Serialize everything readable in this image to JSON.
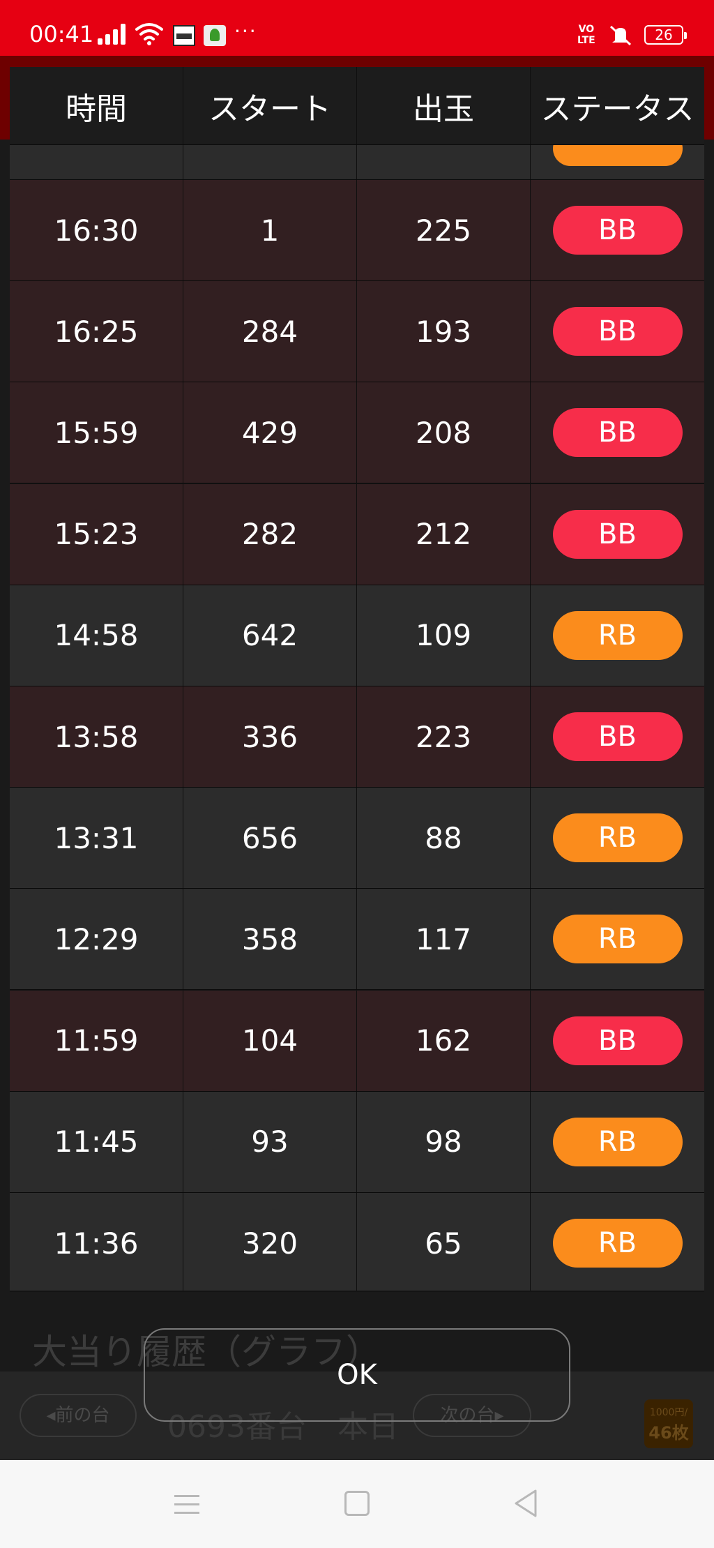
{
  "status_bar": {
    "time": "00:41",
    "more": "···",
    "volte": [
      "VO",
      "LTE"
    ],
    "battery": "26",
    "icons": [
      "signal-icon",
      "wifi-icon",
      "app-notification-icon",
      "app-notification-icon",
      "volte-icon",
      "mute-icon",
      "battery-icon"
    ]
  },
  "table": {
    "headers": [
      "時間",
      "スタート",
      "出玉",
      "ステータス"
    ],
    "rows": [
      {
        "time": "16:30",
        "start": "1",
        "payout": "225",
        "status": "BB"
      },
      {
        "time": "16:25",
        "start": "284",
        "payout": "193",
        "status": "BB"
      },
      {
        "time": "15:59",
        "start": "429",
        "payout": "208",
        "status": "BB"
      },
      {
        "time": "15:23",
        "start": "282",
        "payout": "212",
        "status": "BB"
      },
      {
        "time": "14:58",
        "start": "642",
        "payout": "109",
        "status": "RB"
      },
      {
        "time": "13:58",
        "start": "336",
        "payout": "223",
        "status": "BB"
      },
      {
        "time": "13:31",
        "start": "656",
        "payout": "88",
        "status": "RB"
      },
      {
        "time": "12:29",
        "start": "358",
        "payout": "117",
        "status": "RB"
      },
      {
        "time": "11:59",
        "start": "104",
        "payout": "162",
        "status": "BB"
      },
      {
        "time": "11:45",
        "start": "93",
        "payout": "98",
        "status": "RB"
      },
      {
        "time": "11:36",
        "start": "320",
        "payout": "65",
        "status": "RB"
      }
    ]
  },
  "colors": {
    "status_bar": "#e60012",
    "bb": "#f72d4a",
    "rb": "#fb8c1c",
    "bb_row": "#321f21",
    "rb_row": "#2c2c2c"
  },
  "modal": {
    "ok_label": "OK"
  },
  "background_page": {
    "section_title": "大当り履歴（グラフ）",
    "prev_label": "前の台",
    "next_label": "次の台",
    "machine": "0693番台　本日",
    "badge_small": "1000円/",
    "badge_big": "46枚"
  },
  "nav": {
    "icons": [
      "menu-icon",
      "home-icon",
      "back-icon"
    ]
  }
}
